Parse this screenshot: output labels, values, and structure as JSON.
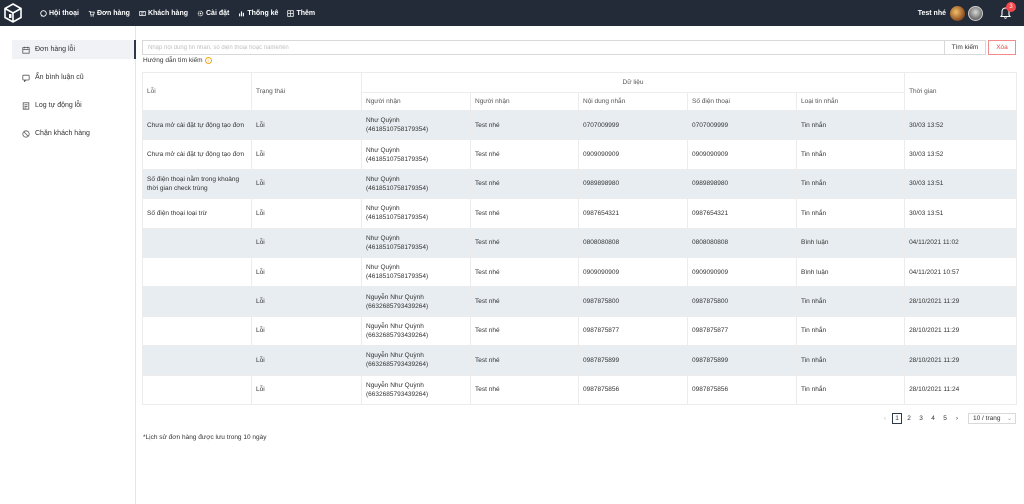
{
  "nav": {
    "items": [
      {
        "label": "Hội thoại",
        "icon": "chat-icon"
      },
      {
        "label": "Đơn hàng",
        "icon": "cart-icon"
      },
      {
        "label": "Khách hàng",
        "icon": "customer-icon"
      },
      {
        "label": "Cài đặt",
        "icon": "gear-icon"
      },
      {
        "label": "Thống kê",
        "icon": "chart-icon"
      },
      {
        "label": "Thêm",
        "icon": "grid-icon"
      }
    ],
    "user_name": "Test nhé",
    "notification_count": "3"
  },
  "sidebar": {
    "items": [
      {
        "label": "Đơn hàng lỗi",
        "icon": "calendar-icon",
        "active": true
      },
      {
        "label": "Ẩn bình luận cũ",
        "icon": "comment-icon"
      },
      {
        "label": "Log tự động lỗi",
        "icon": "log-icon"
      },
      {
        "label": "Chặn khách hàng",
        "icon": "block-icon"
      }
    ]
  },
  "search": {
    "placeholder": "Nhập nội dung tin nhắn, số điện thoại hoặc name/tên",
    "value": "",
    "search_label": "Tìm kiếm",
    "clear_label": "Xóa",
    "guide_label": "Hướng dẫn tìm kiếm"
  },
  "table": {
    "headers": {
      "error": "Lỗi",
      "status": "Trạng thái",
      "data_group": "Dữ liệu",
      "recipient": "Người nhận",
      "recipient2": "Người nhận",
      "content": "Nội dung nhắn",
      "phone": "Số điện thoại",
      "message_type": "Loại tin nhắn",
      "time": "Thời gian"
    },
    "rows": [
      {
        "error": "Chưa mở cài đặt tự động tạo đơn",
        "status": "Lỗi",
        "recipient_name": "Như Quỳnh",
        "recipient_id": "(4618510758179354)",
        "recipient2": "Test nhé",
        "content": "0707009999",
        "phone": "0707009999",
        "type": "Tin nhắn",
        "time": "30/03 13:52"
      },
      {
        "error": "Chưa mở cài đặt tự động tạo đơn",
        "status": "Lỗi",
        "recipient_name": "Như Quỳnh",
        "recipient_id": "(4618510758179354)",
        "recipient2": "Test nhé",
        "content": "0909090909",
        "phone": "0909090909",
        "type": "Tin nhắn",
        "time": "30/03 13:52"
      },
      {
        "error": "Số điện thoại nằm trong khoảng thời gian check trùng",
        "status": "Lỗi",
        "recipient_name": "Như Quỳnh",
        "recipient_id": "(4618510758179354)",
        "recipient2": "Test nhé",
        "content": "0989898980",
        "phone": "0989898980",
        "type": "Tin nhắn",
        "time": "30/03 13:51"
      },
      {
        "error": "Số điện thoại loại trừ",
        "status": "Lỗi",
        "recipient_name": "Như Quỳnh",
        "recipient_id": "(4618510758179354)",
        "recipient2": "Test nhé",
        "content": "0987654321",
        "phone": "0987654321",
        "type": "Tin nhắn",
        "time": "30/03 13:51"
      },
      {
        "error": "",
        "status": "Lỗi",
        "recipient_name": "Như Quỳnh",
        "recipient_id": "(4618510758179354)",
        "recipient2": "Test nhé",
        "content": "0808080808",
        "phone": "0808080808",
        "type": "Bình luận",
        "time": "04/11/2021 11:02"
      },
      {
        "error": "",
        "status": "Lỗi",
        "recipient_name": "Như Quỳnh",
        "recipient_id": "(4618510758179354)",
        "recipient2": "Test nhé",
        "content": "0909090909",
        "phone": "0909090909",
        "type": "Bình luận",
        "time": "04/11/2021 10:57"
      },
      {
        "error": "",
        "status": "Lỗi",
        "recipient_name": "Nguyễn Như Quỳnh",
        "recipient_id": "(6632685793439264)",
        "recipient2": "Test nhé",
        "content": "0987875800",
        "phone": "0987875800",
        "type": "Tin nhắn",
        "time": "28/10/2021 11:29"
      },
      {
        "error": "",
        "status": "Lỗi",
        "recipient_name": "Nguyễn Như Quỳnh",
        "recipient_id": "(6632685793439264)",
        "recipient2": "Test nhé",
        "content": "0987875877",
        "phone": "0987875877",
        "type": "Tin nhắn",
        "time": "28/10/2021 11:29"
      },
      {
        "error": "",
        "status": "Lỗi",
        "recipient_name": "Nguyễn Như Quỳnh",
        "recipient_id": "(6632685793439264)",
        "recipient2": "Test nhé",
        "content": "0987875899",
        "phone": "0987875899",
        "type": "Tin nhắn",
        "time": "28/10/2021 11:29"
      },
      {
        "error": "",
        "status": "Lỗi",
        "recipient_name": "Nguyễn Như Quỳnh",
        "recipient_id": "(6632685793439264)",
        "recipient2": "Test nhé",
        "content": "0987875856",
        "phone": "0987875856",
        "type": "Tin nhắn",
        "time": "28/10/2021 11:24"
      }
    ]
  },
  "pagination": {
    "prev": "‹",
    "next": "›",
    "pages": [
      "1",
      "2",
      "3",
      "4",
      "5"
    ],
    "current": "1",
    "page_size": "10 / trang"
  },
  "footnote": "*Lịch sử đơn hàng được lưu trong 10 ngày",
  "colors": {
    "topbar": "#232b38",
    "row_shade": "#e7edf0",
    "clear_button": "#e24a4a",
    "badge": "#f5484d"
  }
}
